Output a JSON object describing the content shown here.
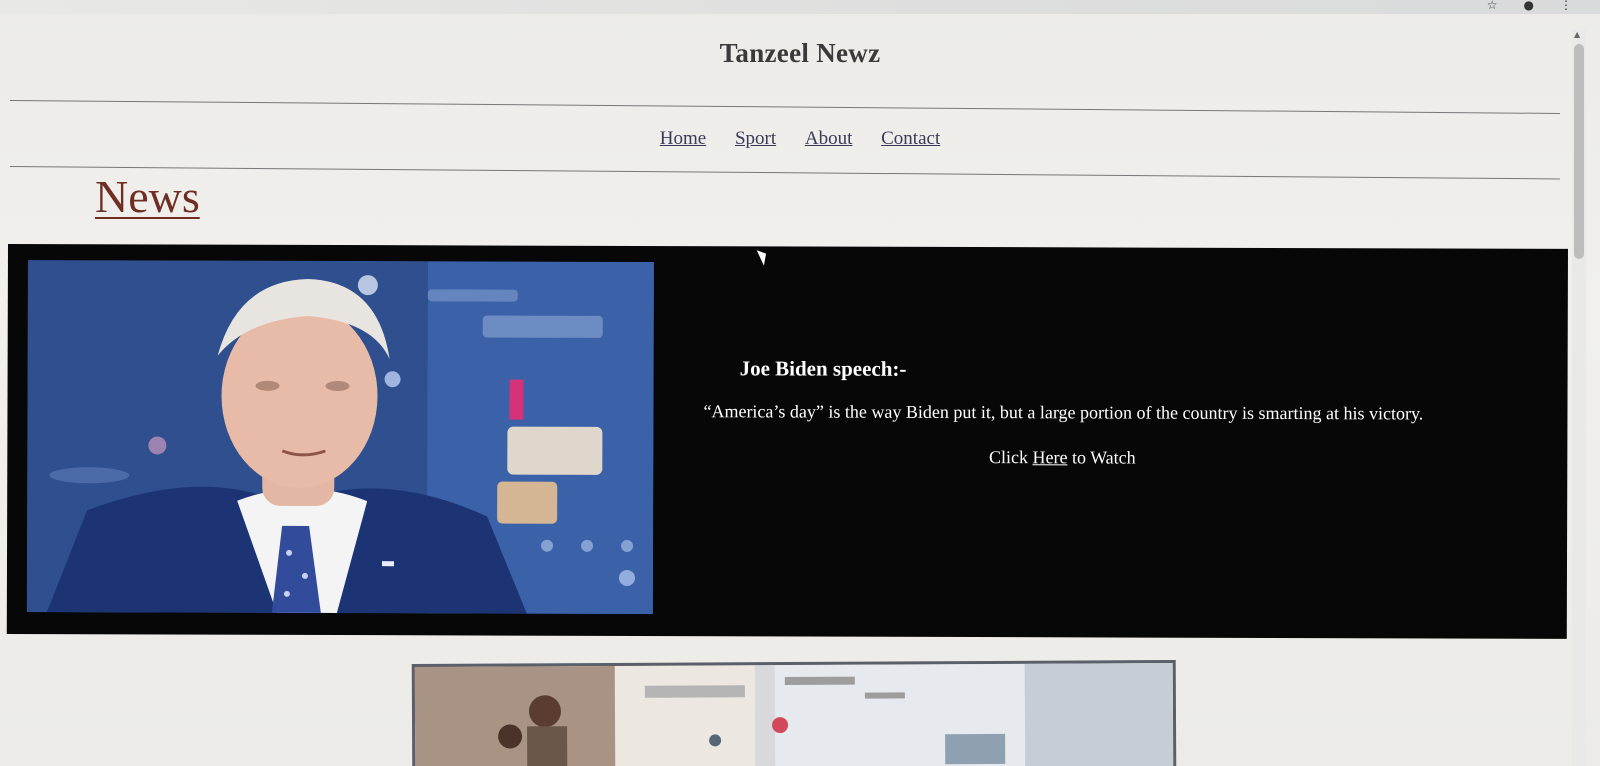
{
  "site": {
    "title": "Tanzeel Newz"
  },
  "nav": {
    "items": [
      {
        "label": "Home"
      },
      {
        "label": "Sport"
      },
      {
        "label": "About"
      },
      {
        "label": "Contact"
      }
    ]
  },
  "section": {
    "heading": "News"
  },
  "featured_article": {
    "headline": "Joe Biden speech:-",
    "summary": "“America’s day” is the way Biden put it, but a large portion of the country is smarting at his victory.",
    "watch_prefix": "Click",
    "watch_link": "Here",
    "watch_suffix": "to Watch"
  },
  "browser": {
    "icons": [
      "star-icon",
      "profile-icon",
      "kebab-menu-icon"
    ]
  },
  "colors": {
    "card_background": "#070707",
    "heading_link": "#6e2e24",
    "nav_link": "#3a3a58",
    "page_background": "#ededea"
  }
}
